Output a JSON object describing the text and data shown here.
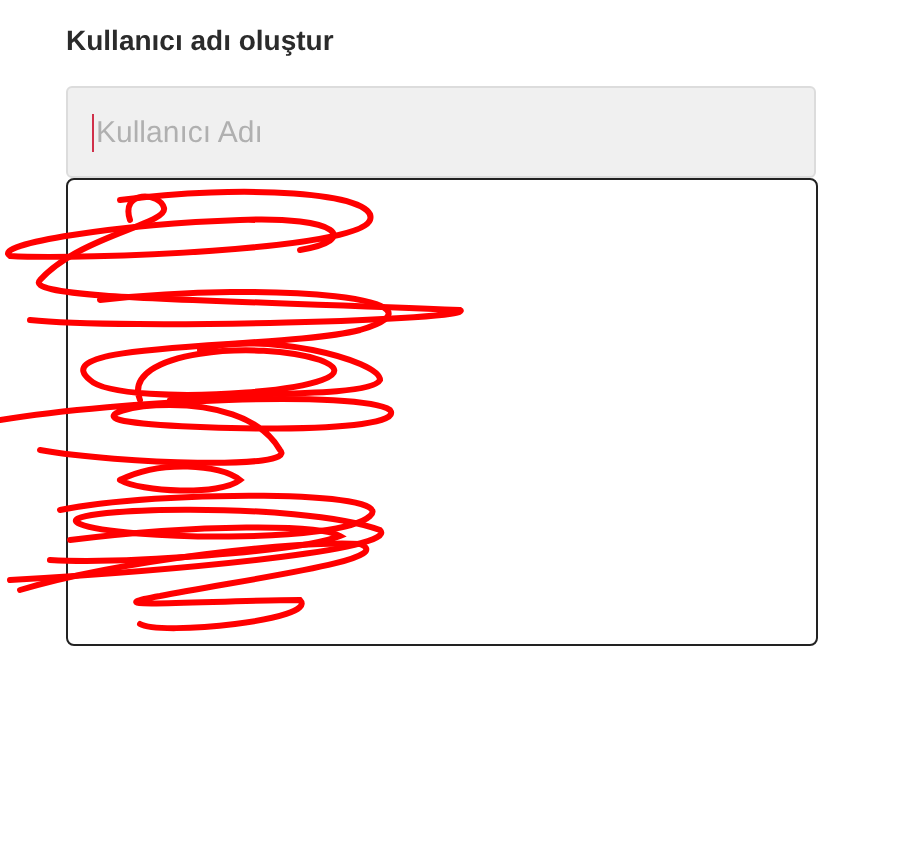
{
  "form": {
    "title": "Kullanıcı adı oluştur",
    "username_field": {
      "placeholder": "Kullanıcı Adı",
      "focused": true
    },
    "suggestions": {
      "kind": "scribbled"
    }
  }
}
